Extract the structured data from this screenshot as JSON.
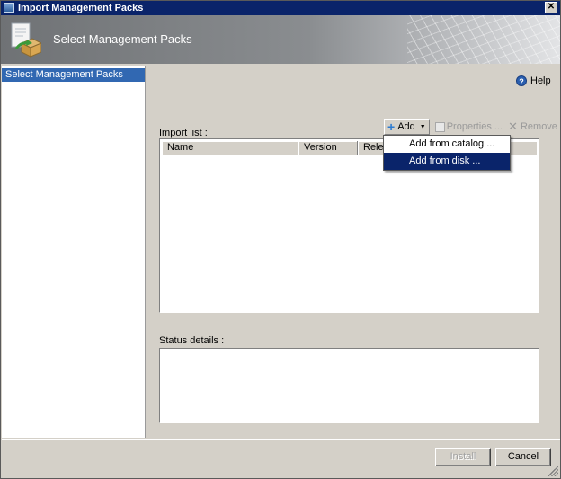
{
  "window": {
    "title": "Import Management Packs"
  },
  "banner": {
    "title": "Select Management Packs",
    "icon": "package-import-icon"
  },
  "nav": {
    "items": [
      {
        "label": "Select Management Packs",
        "active": true
      }
    ]
  },
  "help": {
    "label": "Help"
  },
  "import_list": {
    "label": "Import list :",
    "toolbar": {
      "add": "Add",
      "properties": "Properties ...",
      "remove": "Remove"
    },
    "columns": [
      "Name",
      "Version",
      "Relea"
    ]
  },
  "add_menu": {
    "items": [
      "Add from catalog ...",
      "Add from disk ..."
    ],
    "selected": 1
  },
  "status": {
    "label": "Status details :"
  },
  "buttons": {
    "install": "Install",
    "cancel": "Cancel"
  },
  "colors": {
    "selection": "#0a246a",
    "nav_active": "#3168b2",
    "title_bar": "#0a246a"
  }
}
